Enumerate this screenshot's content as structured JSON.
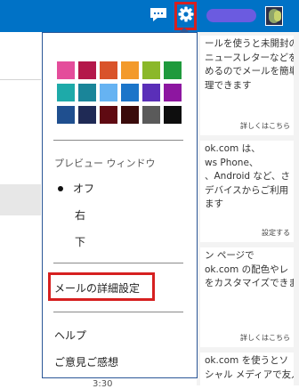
{
  "colors": {
    "topbar": "#0072c6",
    "highlight_border": "#d62020",
    "menu_border": "#2b5797"
  },
  "topbar": {
    "icons": [
      "chat-icon",
      "gear-icon"
    ]
  },
  "menu": {
    "color_swatches": [
      "#e44d9b",
      "#b4174a",
      "#d9532a",
      "#f39a2b",
      "#8bb82a",
      "#1f9a3c",
      "#1eaaa9",
      "#1a8599",
      "#66b3f2",
      "#1c75c9",
      "#5a2fb8",
      "#8d16a0",
      "#1f4f8f",
      "#1f2a55",
      "#5f0a12",
      "#3a0b0b",
      "#5a5a5a",
      "#0e0e0e"
    ],
    "preview_heading": "プレビュー ウィンドウ",
    "preview_options": [
      "オフ",
      "右",
      "下"
    ],
    "advanced_settings": "メールの詳細設定",
    "help": "ヘルプ",
    "feedback": "ご意見ご感想"
  },
  "background": {
    "cards": [
      {
        "text": "ールを使うと未開封の\nニュースレターなどを\nめるのでメールを簡単\n理できます",
        "link": "詳しくはこちら"
      },
      {
        "text": "ok.com は、\nws Phone、\n、Android など、さ\nデバイスからご利用\nます",
        "link": "設定する"
      },
      {
        "text": "ン ページで\nok.com の配色やレ\nをカスタマイズできま",
        "link": "詳しくはこちら"
      },
      {
        "text": "ok.com を使うとソ\nシャル メディアで友人や",
        "link": ""
      }
    ],
    "time_fragment": "3:30"
  }
}
